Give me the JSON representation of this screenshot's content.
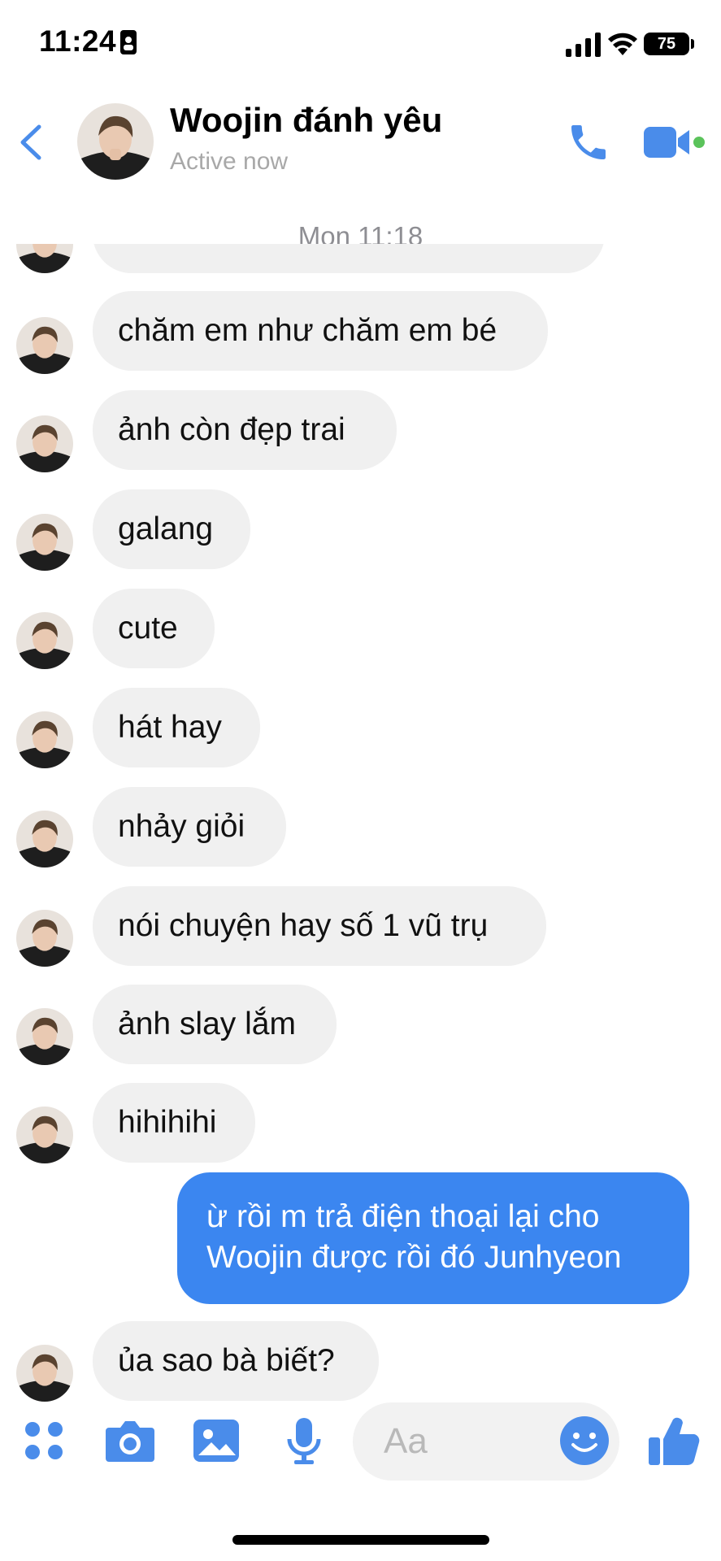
{
  "status_bar": {
    "time": "11:24",
    "battery": "75"
  },
  "header": {
    "back_icon": "chevron-left-icon",
    "name": "Woojin đánh yêu",
    "status": "Active now",
    "accent": "#4a8cea"
  },
  "timestamp": "Mon 11:18",
  "messages_in": [
    {
      "text": "chăm em như chăm em bé"
    },
    {
      "text": "ảnh còn đẹp trai"
    },
    {
      "text": "galang"
    },
    {
      "text": "cute"
    },
    {
      "text": "hát hay"
    },
    {
      "text": "nhảy giỏi"
    },
    {
      "text": "nói chuyện hay số 1 vũ trụ"
    },
    {
      "text": "ảnh slay lắm"
    },
    {
      "text": "hihihihi"
    }
  ],
  "message_out": {
    "line1": "ừ rồi m trả điện thoại lại cho",
    "line2": "Woojin được rồi đó Junhyeon"
  },
  "last_message_in": {
    "text": "ủa sao bà biết?"
  },
  "composer": {
    "placeholder": "Aa"
  },
  "colors": {
    "outgoing_bubble": "#3b86f0",
    "incoming_bubble": "#f0f0f0",
    "icons": "#4a8cea"
  }
}
